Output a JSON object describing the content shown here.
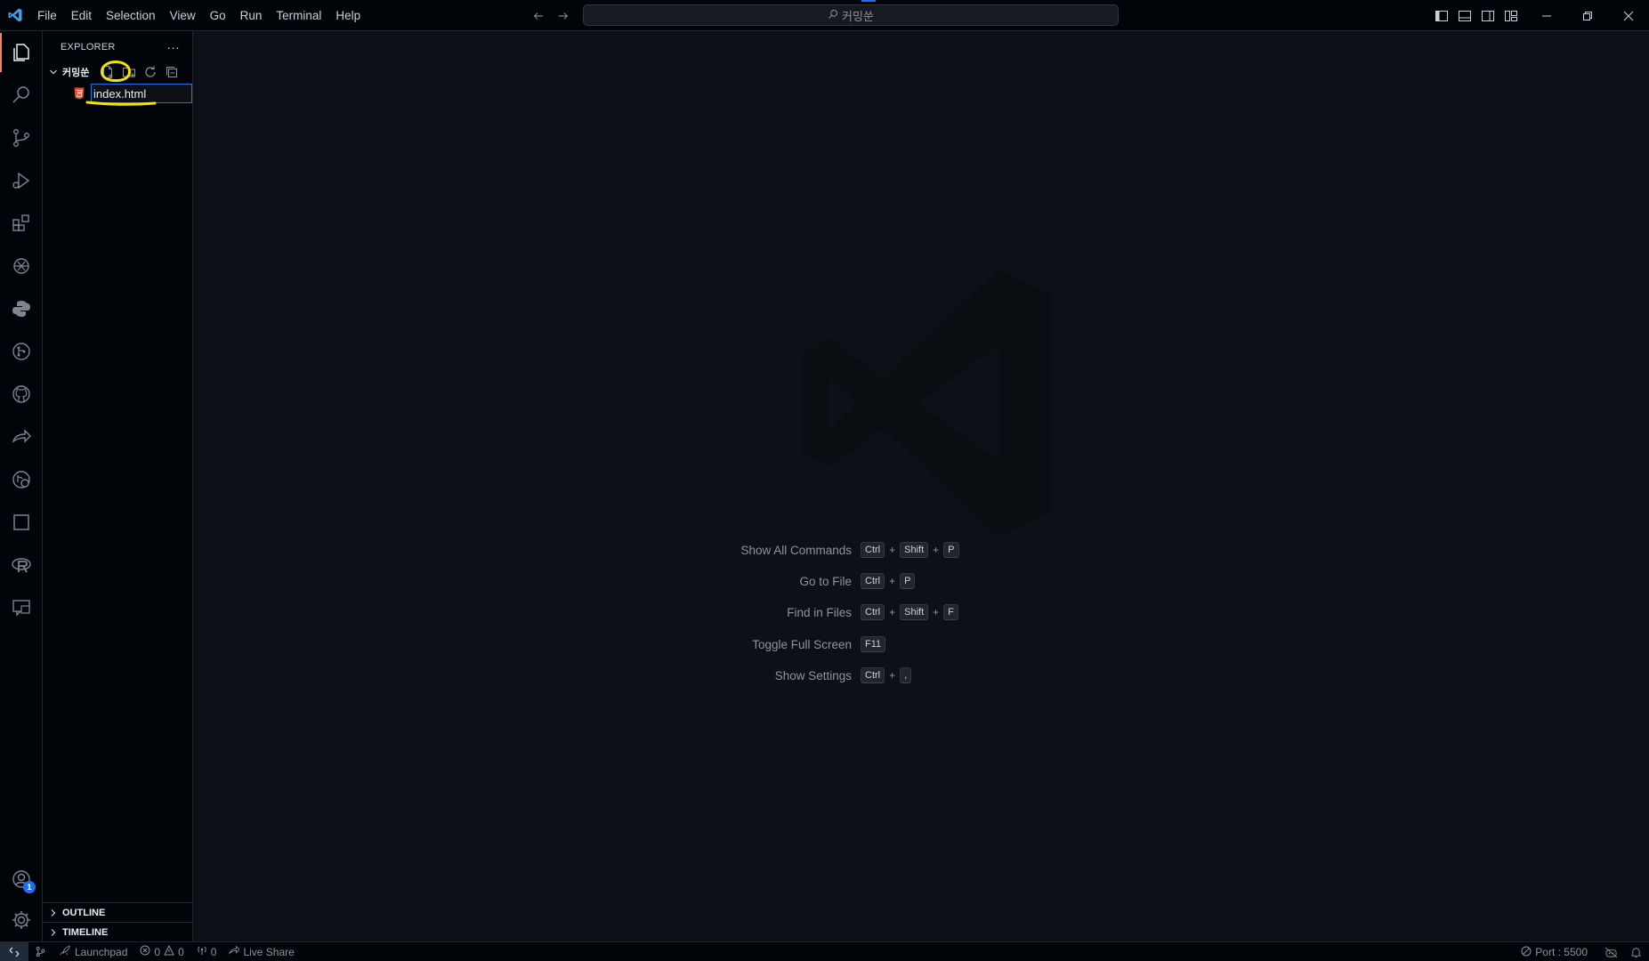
{
  "titlebar": {
    "menu": [
      "File",
      "Edit",
      "Selection",
      "View",
      "Go",
      "Run",
      "Terminal",
      "Help"
    ],
    "search_text": "커밍쑨"
  },
  "sidebar": {
    "title": "EXPLORER",
    "more": "···",
    "folder_name": "커밍쑨",
    "rename_value": "index.html",
    "outline": "OUTLINE",
    "timeline": "TIMELINE"
  },
  "editor": {
    "shortcuts": [
      {
        "label": "Show All Commands",
        "keys": [
          "Ctrl",
          "+",
          "Shift",
          "+",
          "P"
        ]
      },
      {
        "label": "Go to File",
        "keys": [
          "Ctrl",
          "+",
          "P"
        ]
      },
      {
        "label": "Find in Files",
        "keys": [
          "Ctrl",
          "+",
          "Shift",
          "+",
          "F"
        ]
      },
      {
        "label": "Toggle Full Screen",
        "keys": [
          "F11"
        ]
      },
      {
        "label": "Show Settings",
        "keys": [
          "Ctrl",
          "+",
          ","
        ]
      }
    ]
  },
  "statusbar": {
    "launchpad": "Launchpad",
    "errors": "0",
    "warnings": "0",
    "ports_count": "0",
    "live_share": "Live Share",
    "port": "Port : 5500"
  },
  "accounts_badge": "1",
  "colors": {
    "accent": "#1f6feb",
    "annotation": "#f5e400",
    "html_icon": "#e44d26"
  }
}
